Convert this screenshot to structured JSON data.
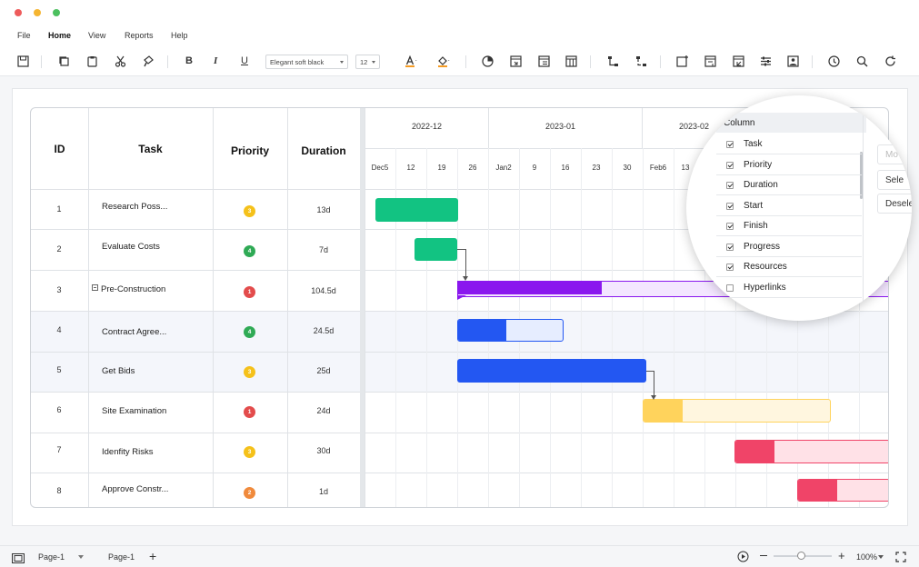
{
  "menu": {
    "items": [
      "File",
      "Home",
      "View",
      "Reports",
      "Help"
    ],
    "active": "Home"
  },
  "toolbar": {
    "font_name": "Elegant soft black",
    "font_size": "12",
    "bold": "B",
    "italic": "I",
    "underline": "U",
    "font_color": "A",
    "font_color_hex": "#f59b23",
    "fill_color_hex": "#f59b23"
  },
  "gantt": {
    "headers": {
      "id": "ID",
      "task": "Task",
      "priority": "Priority",
      "duration": "Duration"
    },
    "months": [
      "2022-12",
      "2023-01",
      "2023-02"
    ],
    "days": [
      "Dec5",
      "12",
      "19",
      "26",
      "Jan2",
      "9",
      "16",
      "23",
      "30",
      "Feb6",
      "13"
    ],
    "rows": [
      {
        "id": "1",
        "task": "Research Poss...",
        "priority": "3",
        "duration": "13d",
        "color": "#f5c11a"
      },
      {
        "id": "2",
        "task": "Evaluate Costs",
        "priority": "4",
        "duration": "7d",
        "color": "#2faa55"
      },
      {
        "id": "3",
        "task": "Pre-Construction",
        "priority": "1",
        "duration": "104.5d",
        "color": "#e34c4c"
      },
      {
        "id": "4",
        "task": "Contract Agree...",
        "priority": "4",
        "duration": "24.5d",
        "color": "#2faa55"
      },
      {
        "id": "5",
        "task": "Get Bids",
        "priority": "3",
        "duration": "25d",
        "color": "#f5c11a"
      },
      {
        "id": "6",
        "task": "Site Examination",
        "priority": "1",
        "duration": "24d",
        "color": "#e34c4c"
      },
      {
        "id": "7",
        "task": "Idenfity Risks",
        "priority": "3",
        "duration": "30d",
        "color": "#f5c11a"
      },
      {
        "id": "8",
        "task": "Approve Constr...",
        "priority": "2",
        "duration": "1d",
        "color": "#f08a3c"
      }
    ],
    "bar_colors": {
      "green": "#12c382",
      "purple": "#8a17ee",
      "purple_light": "#f3e6ff",
      "blue": "#2357f2",
      "blue_light": "#e6edff",
      "yellow": "#ffd35c",
      "yellow_light": "#fff6df",
      "red": "#f04468",
      "red_light": "#ffe1e7"
    }
  },
  "column_panel": {
    "title": "Column",
    "items": [
      {
        "label": "Task",
        "checked": true
      },
      {
        "label": "Priority",
        "checked": true
      },
      {
        "label": "Duration",
        "checked": true
      },
      {
        "label": "Start",
        "checked": true
      },
      {
        "label": "Finish",
        "checked": true
      },
      {
        "label": "Progress",
        "checked": true
      },
      {
        "label": "Resources",
        "checked": true
      },
      {
        "label": "Hyperlinks",
        "checked": false
      }
    ],
    "buttons": [
      "Mo",
      "Sele",
      "Desele"
    ]
  },
  "statusbar": {
    "page_select": "Page-1",
    "page_tab": "Page-1",
    "zoom": "100%"
  }
}
